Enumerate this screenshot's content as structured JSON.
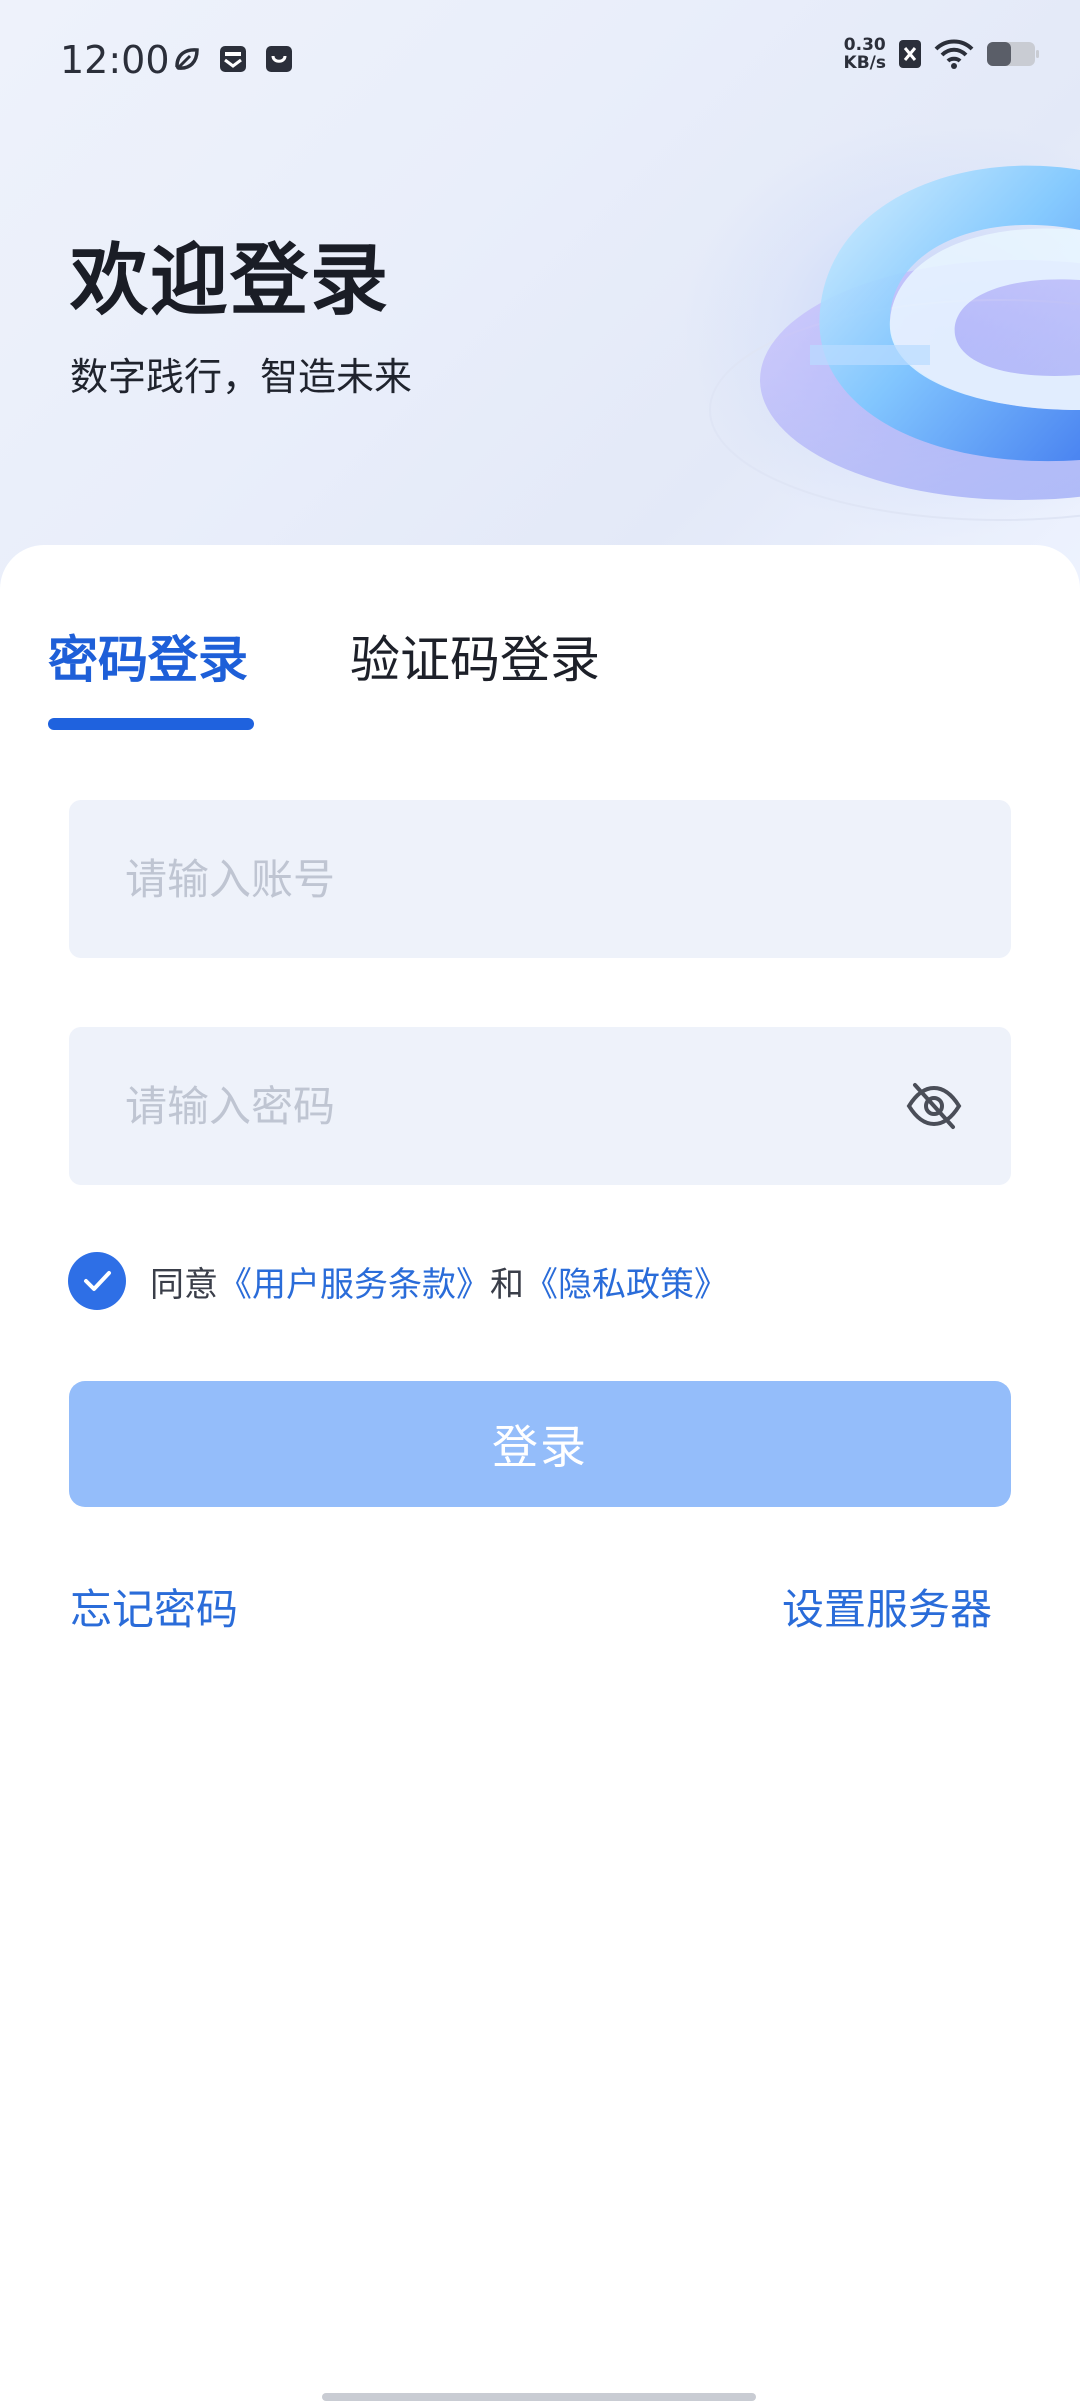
{
  "status_bar": {
    "time": "12:00",
    "net_speed_value": "0.30",
    "net_speed_unit": "KB/s",
    "left_icons": [
      "leaf-icon",
      "inbox-icon",
      "shopping-bag-icon"
    ],
    "right_icons": [
      "sim-disabled-icon",
      "wifi-icon",
      "battery-icon"
    ]
  },
  "header": {
    "title": "欢迎登录",
    "subtitle": "数字践行，智造未来"
  },
  "tabs": [
    {
      "label": "密码登录",
      "active": true
    },
    {
      "label": "验证码登录",
      "active": false
    }
  ],
  "form": {
    "account": {
      "placeholder": "请输入账号",
      "value": ""
    },
    "password": {
      "placeholder": "请输入密码",
      "value": "",
      "toggle_icon": "eye-off-icon"
    }
  },
  "agreement": {
    "checked": true,
    "prefix": "同意",
    "terms_link": "《用户服务条款》",
    "connector": "和",
    "privacy_link": "《隐私政策》"
  },
  "login_button": {
    "label": "登录"
  },
  "links": {
    "forgot_password": "忘记密码",
    "server_settings": "设置服务器"
  },
  "colors": {
    "accent": "#1f62de",
    "link": "#2a6cd9",
    "button_disabled": "#94bdfa",
    "input_bg": "#eef2fa"
  }
}
